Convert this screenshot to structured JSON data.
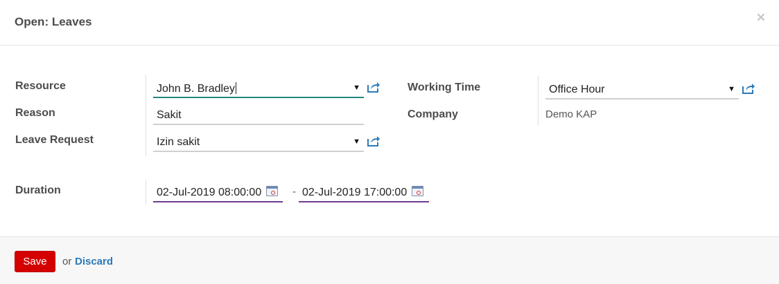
{
  "dialog": {
    "title": "Open: Leaves",
    "close_glyph": "×"
  },
  "form": {
    "resource": {
      "label": "Resource",
      "value": "John B. Bradley"
    },
    "reason": {
      "label": "Reason",
      "value": "Sakit"
    },
    "leave_request": {
      "label": "Leave Request",
      "value": "Izin sakit"
    },
    "working_time": {
      "label": "Working Time",
      "value": "Office Hour"
    },
    "company": {
      "label": "Company",
      "value": "Demo KAP"
    },
    "duration": {
      "label": "Duration",
      "start": "02-Jul-2019 08:00:00",
      "separator": "-",
      "end": "02-Jul-2019 17:00:00"
    },
    "dropdown_caret": "▼",
    "icons": {
      "external_link": "external-link-icon",
      "calendar": "calendar-icon",
      "dropdown": "caret-down-icon"
    }
  },
  "footer": {
    "save_label": "Save",
    "or_text": "or",
    "discard_label": "Discard"
  },
  "colors": {
    "save_button": "#d40000",
    "link_blue": "#2c7ab8",
    "active_field_underline": "#21877d",
    "date_field_underline": "#6f3a93",
    "field_underline": "#cfcfcf"
  }
}
